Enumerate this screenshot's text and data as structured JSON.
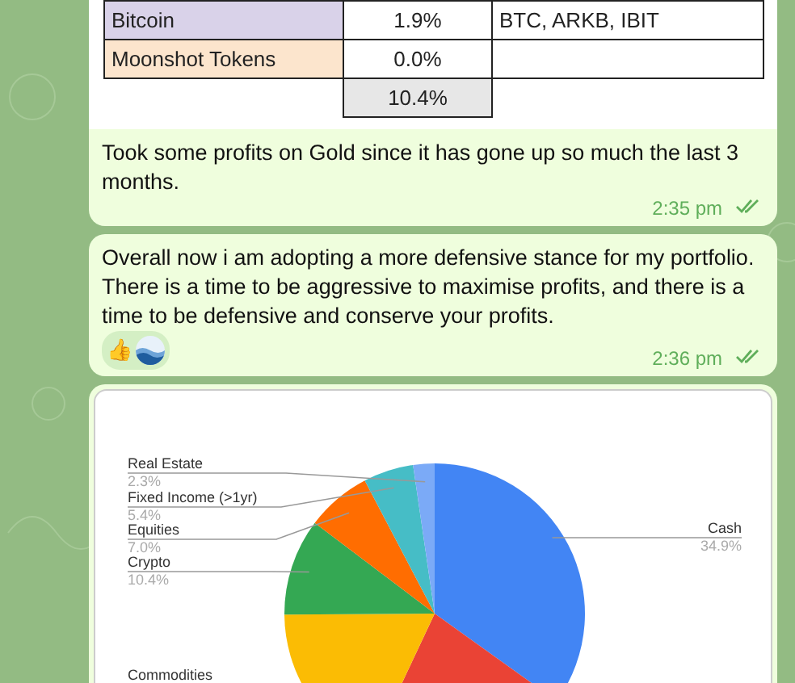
{
  "table": {
    "rows": [
      {
        "cells": [
          "Bitcoin",
          "1.9%",
          "BTC, ARKB, IBIT"
        ],
        "color": "#d9d2e9"
      },
      {
        "cells": [
          "Moonshot Tokens",
          "0.0%",
          null
        ],
        "color": "#fce5cd"
      }
    ],
    "total": "10.4%"
  },
  "messages": [
    {
      "text": "Took some profits on Gold since it has gone up so much the last 3 months.",
      "time": "2:35 pm",
      "read": true
    },
    {
      "text": "Overall now i am adopting a more defensive stance for my portfolio. There is a time to be aggressive to maximise profits, and there is a time to be defensive and conserve your profits.",
      "time": "2:36 pm",
      "read": true,
      "reactions": [
        {
          "kind": "emoji",
          "emoji": "👍"
        },
        {
          "kind": "picture"
        }
      ]
    }
  ],
  "chart": {
    "chart_data": {
      "type": "pie",
      "categories": [
        "Cash",
        null,
        "Commodities",
        "Crypto",
        "Equities",
        "Fixed Income (>1yr)",
        "Real Estate"
      ],
      "values": [
        34.9,
        22.1,
        17.9,
        10.4,
        7.0,
        5.4,
        2.3
      ],
      "colors": [
        "#4285f4",
        "#ea4335",
        "#fbbc04",
        "#34a853",
        "#ff6d01",
        "#46bdc6",
        "#7baaf7"
      ],
      "value_labels": [
        "34.9%",
        null,
        null,
        "10.4%",
        "7.0%",
        "5.4%",
        "2.3%"
      ]
    }
  }
}
